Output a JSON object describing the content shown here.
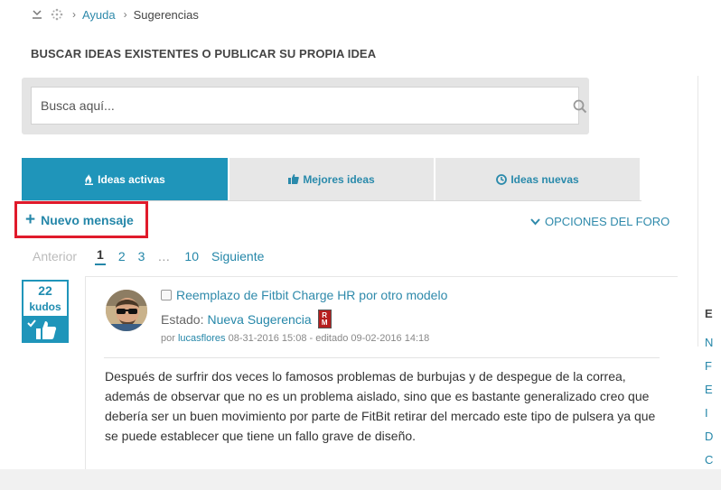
{
  "breadcrumb": {
    "items": [
      {
        "label": "Ayuda",
        "link": true
      },
      {
        "label": "Sugerencias",
        "link": false
      }
    ]
  },
  "page_title": "BUSCAR IDEAS EXISTENTES O PUBLICAR SU PROPIA IDEA",
  "search": {
    "placeholder": "Busca aquí...",
    "value": ""
  },
  "tabs": [
    {
      "label": "Ideas activas",
      "icon": "flame-icon",
      "active": true
    },
    {
      "label": "Mejores ideas",
      "icon": "thumbs-up-icon",
      "active": false
    },
    {
      "label": "Ideas nuevas",
      "icon": "clock-icon",
      "active": false
    }
  ],
  "new_message": {
    "label": "Nuevo mensaje",
    "highlight_color": "#e01a2b"
  },
  "forum_options": {
    "label": "OPCIONES DEL FORO"
  },
  "pagination": {
    "prev": "Anterior",
    "pages": [
      "1",
      "2",
      "3"
    ],
    "ellipsis": "…",
    "last": "10",
    "next": "Siguiente",
    "current": "1"
  },
  "post": {
    "kudos": {
      "count": "22",
      "label": "kudos"
    },
    "title": "Reemplazo de Fitbit Charge HR por otro modelo",
    "status_label": "Estado:",
    "status_value": "Nueva Sugerencia",
    "status_badge": {
      "top": "R",
      "bottom": "M"
    },
    "meta_prefix": "por",
    "author": "lucasflores",
    "date": "08-31-2016 15:08",
    "edited": "- editado 09-02-2016 14:18",
    "body": "Después de surfrir dos veces lo famosos problemas de burbujas y de despegue de la correa, además de observar que no es un problema aislado, sino que es bastante generalizado creo que debería ser un buen movimiento por parte de FitBit retirar del mercado este tipo de pulsera ya que se puede establecer que tiene un fallo grave de diseño."
  },
  "sidebar_clipped": {
    "heading": "E",
    "items": [
      "N",
      "F",
      "E",
      "I",
      "D",
      "C"
    ]
  },
  "colors": {
    "accent": "#1f95ba",
    "link": "#2587a9",
    "tab_inactive": "#e7e7e7"
  }
}
